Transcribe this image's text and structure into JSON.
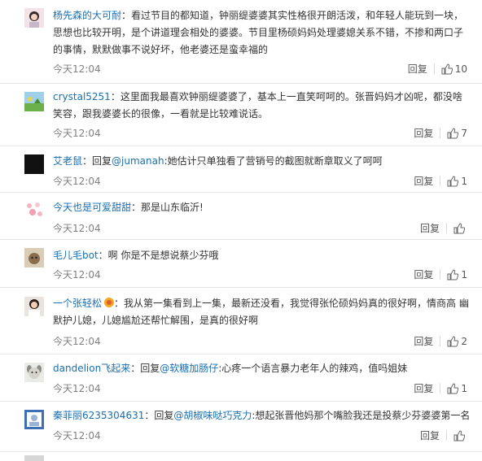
{
  "comments": [
    {
      "username": "杨先森的大可耐",
      "content": "：看过节目的都知道，钟丽缇婆婆其实性格很开朗活泼，和年轻人能玩到一块，思想也比较开明，是个讲道理会相处的婆婆。节目里杨硕妈妈处理婆媳关系不错，不掺和两口子的事情，默默做事不说好坏，他老婆还是蛮幸福的",
      "time": "今天12:04",
      "reply": "回复",
      "likes": "10",
      "avatar": "girl-avatar"
    },
    {
      "username": "crystal5251",
      "content": "：这里面我最喜欢钟丽缇婆婆了，基本上一直笑呵呵的。张晋妈妈才凶呢，都没啥笑容，跟我婆婆长的很像，一看就是比较难说话。",
      "time": "今天12:04",
      "reply": "回复",
      "likes": "7",
      "avatar": "landscape-avatar"
    },
    {
      "username": "艾老鼠",
      "content_prefix": "：回复",
      "mention": "@jumanah",
      "content": ":她估计只单独看了营销号的截图就断章取义了呵呵",
      "time": "今天12:04",
      "reply": "回复",
      "likes": "1",
      "avatar": "black-avatar"
    },
    {
      "username": "今天也是可爱甜甜",
      "content": "：那是山东临沂!",
      "time": "今天12:04",
      "reply": "回复",
      "likes": "",
      "avatar": "hearts-avatar"
    },
    {
      "username": "毛儿毛bot",
      "content": "：啊 你是不是想说蔡少芬哦",
      "time": "今天12:04",
      "reply": "回复",
      "likes": "1",
      "avatar": "cat-avatar"
    },
    {
      "username": "一个张轻松",
      "content": "：我从第一集看到上一集，最新还没看，我觉得张伦硕妈妈真的很好啊，情商高 幽默护儿媳，儿媳尴尬还帮忙解围，是真的很好啊",
      "time": "今天12:04",
      "reply": "回复",
      "likes": "2",
      "avatar": "woman-avatar"
    },
    {
      "username": "dandelion飞起来",
      "content_prefix": "：回复",
      "mention": "@软糖加肠仔",
      "content": ":心疼一个语言暴力老年人的辣鸡，值吗姐妹",
      "time": "今天12:04",
      "reply": "回复",
      "likes": "1",
      "avatar": "dog-avatar"
    },
    {
      "username": "秦菲丽6235304631",
      "content_prefix": "：回复",
      "mention": "@胡椒味哒巧克力",
      "content": ":想起张晋他妈那个嘴脸我还是投蔡少芬婆婆第一名",
      "time": "今天12:04",
      "reply": "回复",
      "likes": "",
      "avatar": "default-avatar"
    }
  ],
  "colors": {
    "link": "#1a6fb0",
    "time": "#808080",
    "divider": "#e6e6e6"
  }
}
